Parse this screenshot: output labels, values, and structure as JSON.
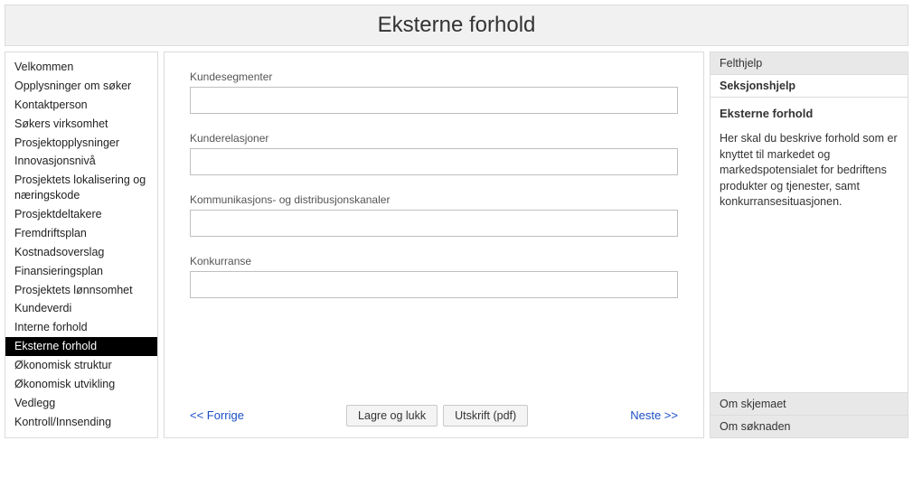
{
  "header": {
    "title": "Eksterne forhold"
  },
  "sidebar": {
    "items": [
      {
        "label": "Velkommen",
        "active": false
      },
      {
        "label": "Opplysninger om søker",
        "active": false
      },
      {
        "label": "Kontaktperson",
        "active": false
      },
      {
        "label": "Søkers virksomhet",
        "active": false
      },
      {
        "label": "Prosjektopplysninger",
        "active": false
      },
      {
        "label": "Innovasjonsnivå",
        "active": false
      },
      {
        "label": "Prosjektets lokalisering og næringskode",
        "active": false
      },
      {
        "label": "Prosjektdeltakere",
        "active": false
      },
      {
        "label": "Fremdriftsplan",
        "active": false
      },
      {
        "label": "Kostnadsoverslag",
        "active": false
      },
      {
        "label": "Finansieringsplan",
        "active": false
      },
      {
        "label": "Prosjektets lønnsomhet",
        "active": false
      },
      {
        "label": "Kundeverdi",
        "active": false
      },
      {
        "label": "Interne forhold",
        "active": false
      },
      {
        "label": "Eksterne forhold",
        "active": true
      },
      {
        "label": "Økonomisk struktur",
        "active": false
      },
      {
        "label": "Økonomisk utvikling",
        "active": false
      },
      {
        "label": "Vedlegg",
        "active": false
      },
      {
        "label": "Kontroll/Innsending",
        "active": false
      }
    ]
  },
  "form": {
    "fields": [
      {
        "label": "Kundesegmenter",
        "value": ""
      },
      {
        "label": "Kunderelasjoner",
        "value": ""
      },
      {
        "label": "Kommunikasjons- og distribusjonskanaler",
        "value": ""
      },
      {
        "label": "Konkurranse",
        "value": ""
      }
    ]
  },
  "footer": {
    "prev": "<< Forrige",
    "save": "Lagre og lukk",
    "print": "Utskrift (pdf)",
    "next": "Neste >>"
  },
  "help": {
    "felthjelp": "Felthjelp",
    "seksjonshjelp": "Seksjonshjelp",
    "title": "Eksterne forhold",
    "body": "Her skal du beskrive forhold som er knyttet til markedet og markedspotensialet for bedriftens produkter og tjenester, samt konkurransesituasjonen.",
    "om_skjemaet": "Om skjemaet",
    "om_soknaden": "Om søknaden"
  }
}
